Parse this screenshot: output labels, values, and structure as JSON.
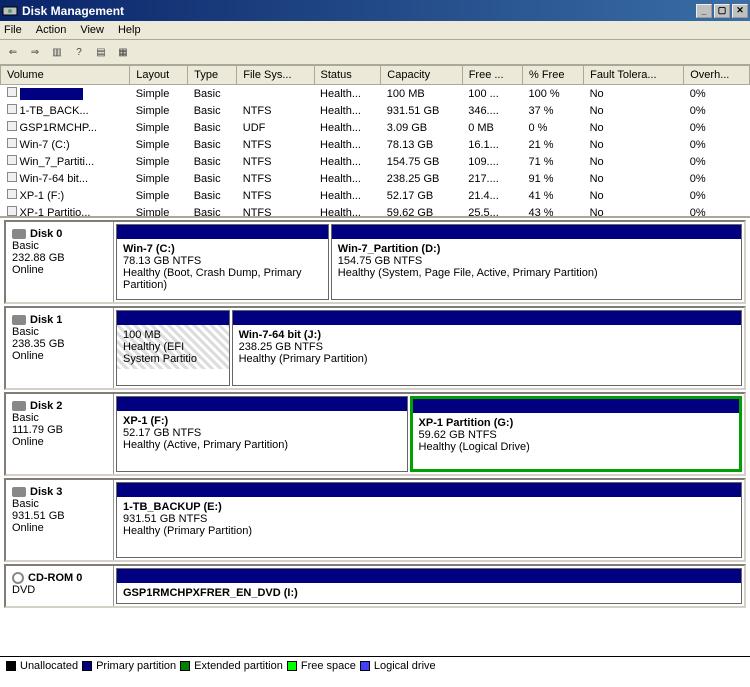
{
  "window": {
    "title": "Disk Management"
  },
  "menu": {
    "file": "File",
    "action": "Action",
    "view": "View",
    "help": "Help"
  },
  "columns": {
    "volume": "Volume",
    "layout": "Layout",
    "type": "Type",
    "fs": "File Sys...",
    "status": "Status",
    "capacity": "Capacity",
    "free": "Free ...",
    "pfree": "% Free",
    "fault": "Fault Tolera...",
    "over": "Overh..."
  },
  "volumes": [
    {
      "name": "",
      "layout": "Simple",
      "type": "Basic",
      "fs": "",
      "status": "Health...",
      "capacity": "100 MB",
      "free": "100 ...",
      "pfree": "100 %",
      "fault": "No",
      "over": "0%"
    },
    {
      "name": "1-TB_BACK...",
      "layout": "Simple",
      "type": "Basic",
      "fs": "NTFS",
      "status": "Health...",
      "capacity": "931.51 GB",
      "free": "346....",
      "pfree": "37 %",
      "fault": "No",
      "over": "0%"
    },
    {
      "name": "GSP1RMCHP...",
      "layout": "Simple",
      "type": "Basic",
      "fs": "UDF",
      "status": "Health...",
      "capacity": "3.09 GB",
      "free": "0 MB",
      "pfree": "0 %",
      "fault": "No",
      "over": "0%"
    },
    {
      "name": "Win-7 (C:)",
      "layout": "Simple",
      "type": "Basic",
      "fs": "NTFS",
      "status": "Health...",
      "capacity": "78.13 GB",
      "free": "16.1...",
      "pfree": "21 %",
      "fault": "No",
      "over": "0%"
    },
    {
      "name": "Win_7_Partiti...",
      "layout": "Simple",
      "type": "Basic",
      "fs": "NTFS",
      "status": "Health...",
      "capacity": "154.75 GB",
      "free": "109....",
      "pfree": "71 %",
      "fault": "No",
      "over": "0%"
    },
    {
      "name": "Win-7-64 bit...",
      "layout": "Simple",
      "type": "Basic",
      "fs": "NTFS",
      "status": "Health...",
      "capacity": "238.25 GB",
      "free": "217....",
      "pfree": "91 %",
      "fault": "No",
      "over": "0%"
    },
    {
      "name": "XP-1 (F:)",
      "layout": "Simple",
      "type": "Basic",
      "fs": "NTFS",
      "status": "Health...",
      "capacity": "52.17 GB",
      "free": "21.4...",
      "pfree": "41 %",
      "fault": "No",
      "over": "0%"
    },
    {
      "name": "XP-1 Partitio...",
      "layout": "Simple",
      "type": "Basic",
      "fs": "NTFS",
      "status": "Health...",
      "capacity": "59.62 GB",
      "free": "25.5...",
      "pfree": "43 %",
      "fault": "No",
      "over": "0%"
    }
  ],
  "disks": {
    "d0": {
      "label": "Disk 0",
      "type": "Basic",
      "size": "232.88 GB",
      "status": "Online",
      "p1": {
        "name": "Win-7  (C:)",
        "size": "78.13 GB NTFS",
        "st": "Healthy (Boot, Crash Dump, Primary Partition)"
      },
      "p2": {
        "name": "Win-7_Partition  (D:)",
        "size": "154.75 GB NTFS",
        "st": "Healthy (System, Page File, Active, Primary Partition)"
      }
    },
    "d1": {
      "label": "Disk 1",
      "type": "Basic",
      "size": "238.35 GB",
      "status": "Online",
      "p1": {
        "name": "",
        "size": "100 MB",
        "st": "Healthy (EFI System Partitio"
      },
      "p2": {
        "name": "Win-7-64 bit  (J:)",
        "size": "238.25 GB NTFS",
        "st": "Healthy (Primary Partition)"
      }
    },
    "d2": {
      "label": "Disk 2",
      "type": "Basic",
      "size": "111.79 GB",
      "status": "Online",
      "p1": {
        "name": "XP-1  (F:)",
        "size": "52.17 GB NTFS",
        "st": "Healthy (Active, Primary Partition)"
      },
      "p2": {
        "name": "XP-1 Partition  (G:)",
        "size": "59.62 GB NTFS",
        "st": "Healthy (Logical Drive)"
      }
    },
    "d3": {
      "label": "Disk 3",
      "type": "Basic",
      "size": "931.51 GB",
      "status": "Online",
      "p1": {
        "name": "1-TB_BACKUP  (E:)",
        "size": "931.51 GB NTFS",
        "st": "Healthy (Primary Partition)"
      }
    },
    "cd": {
      "label": "CD-ROM 0",
      "type": "DVD",
      "p1": {
        "name": "GSP1RMCHPXFRER_EN_DVD (I:)"
      }
    }
  },
  "legend": {
    "unalloc": "Unallocated",
    "primary": "Primary partition",
    "ext": "Extended partition",
    "free": "Free space",
    "logical": "Logical drive"
  }
}
